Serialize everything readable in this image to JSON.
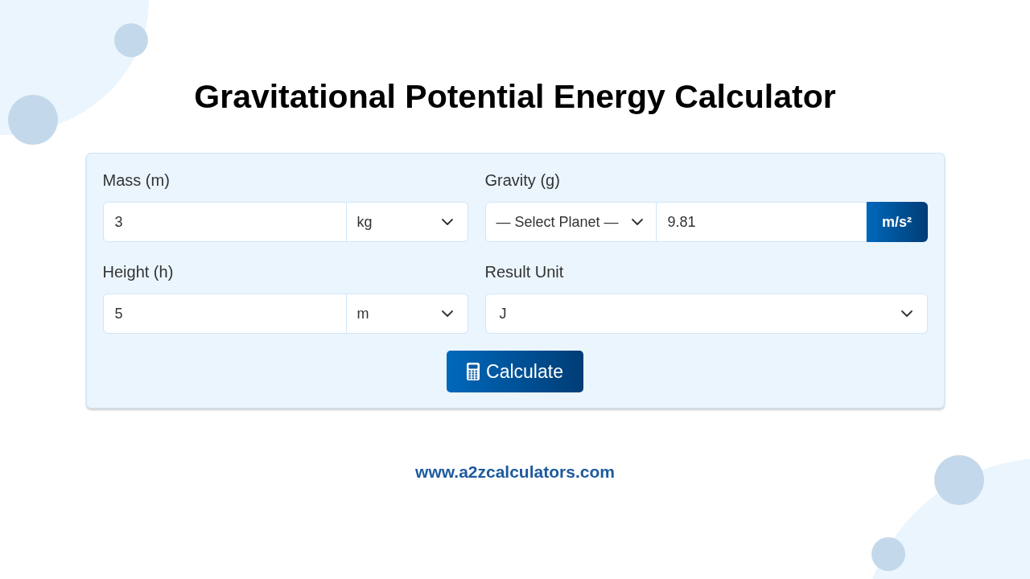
{
  "title": "Gravitational Potential Energy Calculator",
  "form": {
    "fields": [
      {
        "kind": "value_unit",
        "label": "Mass (m)",
        "value": "3",
        "unit": "kg"
      },
      {
        "kind": "planet_gravity",
        "label": "Gravity (g)",
        "planet": "— Select Planet —",
        "value": "9.81",
        "unit": "m/s²"
      },
      {
        "kind": "value_unit",
        "label": "Height (h)",
        "value": "5",
        "unit": "m"
      },
      {
        "kind": "select",
        "label": "Result Unit",
        "value": "J"
      }
    ],
    "button": "Calculate"
  },
  "footer": "www.a2zcalculators.com"
}
